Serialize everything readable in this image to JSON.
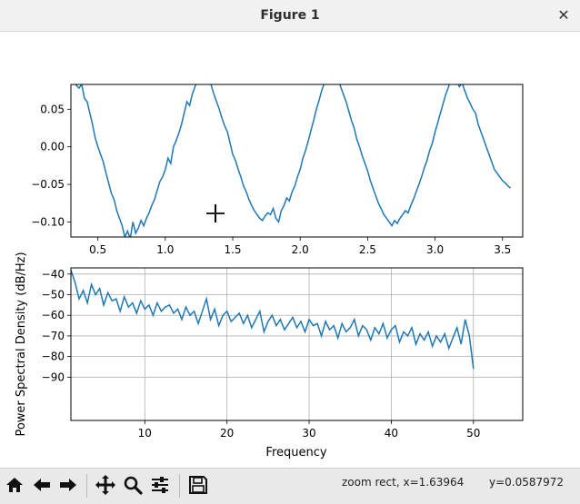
{
  "window": {
    "title": "Figure 1"
  },
  "chart_data": [
    {
      "type": "line",
      "title": "",
      "xlabel": "",
      "ylabel": "",
      "xlim": [
        0.3,
        3.65
      ],
      "ylim": [
        -0.12,
        0.083
      ],
      "xticks": [
        0.5,
        1.0,
        1.5,
        2.0,
        2.5,
        3.0,
        3.5
      ],
      "xtick_labels": [
        "0.5",
        "1.0",
        "1.5",
        "2.0",
        "2.5",
        "3.0",
        "3.5"
      ],
      "yticks": [
        0.05,
        0.0,
        -0.05,
        -0.1
      ],
      "ytick_labels": [
        "0.05",
        "0.00",
        "−0.05",
        "−0.10"
      ],
      "grid": false,
      "color": "#1f77b4",
      "x": [
        0.3,
        0.32,
        0.34,
        0.36,
        0.38,
        0.4,
        0.42,
        0.44,
        0.46,
        0.48,
        0.5,
        0.52,
        0.54,
        0.56,
        0.58,
        0.6,
        0.62,
        0.64,
        0.66,
        0.68,
        0.7,
        0.72,
        0.74,
        0.76,
        0.78,
        0.8,
        0.82,
        0.84,
        0.86,
        0.88,
        0.9,
        0.92,
        0.94,
        0.96,
        0.98,
        1.0,
        1.02,
        1.04,
        1.06,
        1.08,
        1.1,
        1.12,
        1.14,
        1.16,
        1.18,
        1.2,
        1.22,
        1.24,
        1.26,
        1.28,
        1.3,
        1.32,
        1.34,
        1.36,
        1.38,
        1.4,
        1.42,
        1.44,
        1.46,
        1.48,
        1.5,
        1.52,
        1.54,
        1.56,
        1.58,
        1.6,
        1.62,
        1.64,
        1.66,
        1.68,
        1.7,
        1.72,
        1.74,
        1.76,
        1.78,
        1.8,
        1.82,
        1.84,
        1.86,
        1.88,
        1.9,
        1.92,
        1.94,
        1.96,
        1.98,
        2.0,
        2.02,
        2.04,
        2.06,
        2.08,
        2.1,
        2.12,
        2.14,
        2.16,
        2.18,
        2.2,
        2.22,
        2.24,
        2.26,
        2.28,
        2.3,
        2.32,
        2.34,
        2.36,
        2.38,
        2.4,
        2.42,
        2.44,
        2.46,
        2.48,
        2.5,
        2.52,
        2.54,
        2.56,
        2.58,
        2.6,
        2.62,
        2.64,
        2.66,
        2.68,
        2.7,
        2.72,
        2.74,
        2.76,
        2.78,
        2.8,
        2.82,
        2.84,
        2.86,
        2.88,
        2.9,
        2.92,
        2.94,
        2.96,
        2.98,
        3.0,
        3.02,
        3.04,
        3.06,
        3.08,
        3.1,
        3.12,
        3.14,
        3.16,
        3.18,
        3.2,
        3.22,
        3.24,
        3.26,
        3.28,
        3.3,
        3.32,
        3.34,
        3.36,
        3.38,
        3.4,
        3.42,
        3.44,
        3.46,
        3.48,
        3.5,
        3.52,
        3.54,
        3.56,
        3.58,
        3.6,
        3.62,
        3.64
      ],
      "y": [
        0.09,
        0.085,
        0.082,
        0.078,
        0.083,
        0.065,
        0.06,
        0.045,
        0.03,
        0.012,
        0.0,
        -0.01,
        -0.02,
        -0.035,
        -0.048,
        -0.062,
        -0.07,
        -0.085,
        -0.095,
        -0.105,
        -0.12,
        -0.112,
        -0.122,
        -0.1,
        -0.115,
        -0.108,
        -0.098,
        -0.105,
        -0.095,
        -0.088,
        -0.078,
        -0.07,
        -0.058,
        -0.046,
        -0.04,
        -0.03,
        -0.015,
        -0.022,
        0.0,
        0.008,
        0.018,
        0.03,
        0.045,
        0.06,
        0.055,
        0.07,
        0.08,
        0.09,
        0.1,
        0.11,
        0.1,
        0.095,
        0.082,
        0.07,
        0.06,
        0.05,
        0.038,
        0.028,
        0.02,
        0.005,
        -0.01,
        -0.018,
        -0.03,
        -0.04,
        -0.052,
        -0.06,
        -0.07,
        -0.078,
        -0.085,
        -0.09,
        -0.095,
        -0.098,
        -0.092,
        -0.088,
        -0.09,
        -0.082,
        -0.095,
        -0.1,
        -0.085,
        -0.078,
        -0.068,
        -0.072,
        -0.06,
        -0.052,
        -0.04,
        -0.03,
        -0.015,
        -0.005,
        0.008,
        0.022,
        0.035,
        0.05,
        0.062,
        0.075,
        0.085,
        0.095,
        0.105,
        0.11,
        0.1,
        0.092,
        0.08,
        0.07,
        0.06,
        0.048,
        0.035,
        0.025,
        0.01,
        0.0,
        -0.012,
        -0.022,
        -0.032,
        -0.045,
        -0.055,
        -0.065,
        -0.075,
        -0.082,
        -0.09,
        -0.095,
        -0.1,
        -0.105,
        -0.098,
        -0.102,
        -0.095,
        -0.09,
        -0.085,
        -0.088,
        -0.078,
        -0.07,
        -0.06,
        -0.05,
        -0.04,
        -0.028,
        -0.018,
        -0.005,
        0.005,
        0.02,
        0.032,
        0.045,
        0.058,
        0.07,
        0.08,
        0.09,
        0.095,
        0.088,
        0.08,
        0.085,
        0.075,
        0.065,
        0.058,
        0.05,
        0.045,
        0.03,
        0.02,
        0.01,
        0.0,
        -0.01,
        -0.02,
        -0.03,
        -0.035,
        -0.04,
        -0.045,
        -0.048,
        -0.052,
        -0.055
      ]
    },
    {
      "type": "line",
      "title": "",
      "xlabel": "Frequency",
      "ylabel": "Power Spectral Density (dB/Hz)",
      "xlim": [
        1.0,
        56.0
      ],
      "ylim": [
        -111,
        -37
      ],
      "xticks": [
        10,
        20,
        30,
        40,
        50
      ],
      "xtick_labels": [
        "10",
        "20",
        "30",
        "40",
        "50"
      ],
      "yticks": [
        -40,
        -50,
        -60,
        -70,
        -80,
        -90
      ],
      "ytick_labels": [
        "−40",
        "−50",
        "−60",
        "−70",
        "−80",
        "−90"
      ],
      "grid": true,
      "color": "#1f77b4",
      "x": [
        1.0,
        1.5,
        2.0,
        2.5,
        3.0,
        3.5,
        4.0,
        4.5,
        5.0,
        5.5,
        6.0,
        6.5,
        7.0,
        7.5,
        8.0,
        8.5,
        9.0,
        9.5,
        10.0,
        10.5,
        11.0,
        11.5,
        12.0,
        12.5,
        13.0,
        13.5,
        14.0,
        14.5,
        15.0,
        15.5,
        16.0,
        16.5,
        17.0,
        17.5,
        18.0,
        18.5,
        19.0,
        19.5,
        20.0,
        20.5,
        21.0,
        21.5,
        22.0,
        22.5,
        23.0,
        23.5,
        24.0,
        24.5,
        25.0,
        25.5,
        26.0,
        26.5,
        27.0,
        27.5,
        28.0,
        28.5,
        29.0,
        29.5,
        30.0,
        30.5,
        31.0,
        31.5,
        32.0,
        32.5,
        33.0,
        33.5,
        34.0,
        34.5,
        35.0,
        35.5,
        36.0,
        36.5,
        37.0,
        37.5,
        38.0,
        38.5,
        39.0,
        39.5,
        40.0,
        40.5,
        41.0,
        41.5,
        42.0,
        42.5,
        43.0,
        43.5,
        44.0,
        44.5,
        45.0,
        45.5,
        46.0,
        46.5,
        47.0,
        47.5,
        48.0,
        48.5,
        49.0,
        49.5,
        50.0
      ],
      "y": [
        -38,
        -44,
        -52,
        -48,
        -54,
        -45,
        -50,
        -47,
        -55,
        -49,
        -53,
        -52,
        -58,
        -51,
        -56,
        -54,
        -59,
        -53,
        -57,
        -55,
        -60,
        -54,
        -58,
        -56,
        -55,
        -59,
        -57,
        -62,
        -56,
        -60,
        -58,
        -64,
        -58,
        -52,
        -62,
        -57,
        -65,
        -60,
        -58,
        -63,
        -61,
        -59,
        -64,
        -60,
        -66,
        -62,
        -58,
        -68,
        -63,
        -60,
        -65,
        -62,
        -67,
        -64,
        -61,
        -66,
        -63,
        -68,
        -62,
        -65,
        -64,
        -70,
        -63,
        -67,
        -65,
        -71,
        -64,
        -68,
        -66,
        -62,
        -70,
        -65,
        -67,
        -72,
        -66,
        -69,
        -64,
        -71,
        -67,
        -65,
        -73,
        -68,
        -70,
        -66,
        -74,
        -69,
        -72,
        -68,
        -75,
        -70,
        -73,
        -69,
        -76,
        -71,
        -66,
        -74,
        -62,
        -70,
        -86
      ]
    }
  ],
  "toolbar": {
    "buttons": [
      {
        "name": "home-button",
        "icon": "home-icon"
      },
      {
        "name": "back-button",
        "icon": "arrow-left-icon"
      },
      {
        "name": "forward-button",
        "icon": "arrow-right-icon"
      },
      {
        "name": "pan-button",
        "icon": "move-icon"
      },
      {
        "name": "zoom-button",
        "icon": "magnifier-icon"
      },
      {
        "name": "subplots-button",
        "icon": "sliders-icon"
      },
      {
        "name": "save-button",
        "icon": "floppy-icon"
      }
    ],
    "status_left": "zoom rect, x=1.63964",
    "status_right": "y=0.0587972"
  }
}
